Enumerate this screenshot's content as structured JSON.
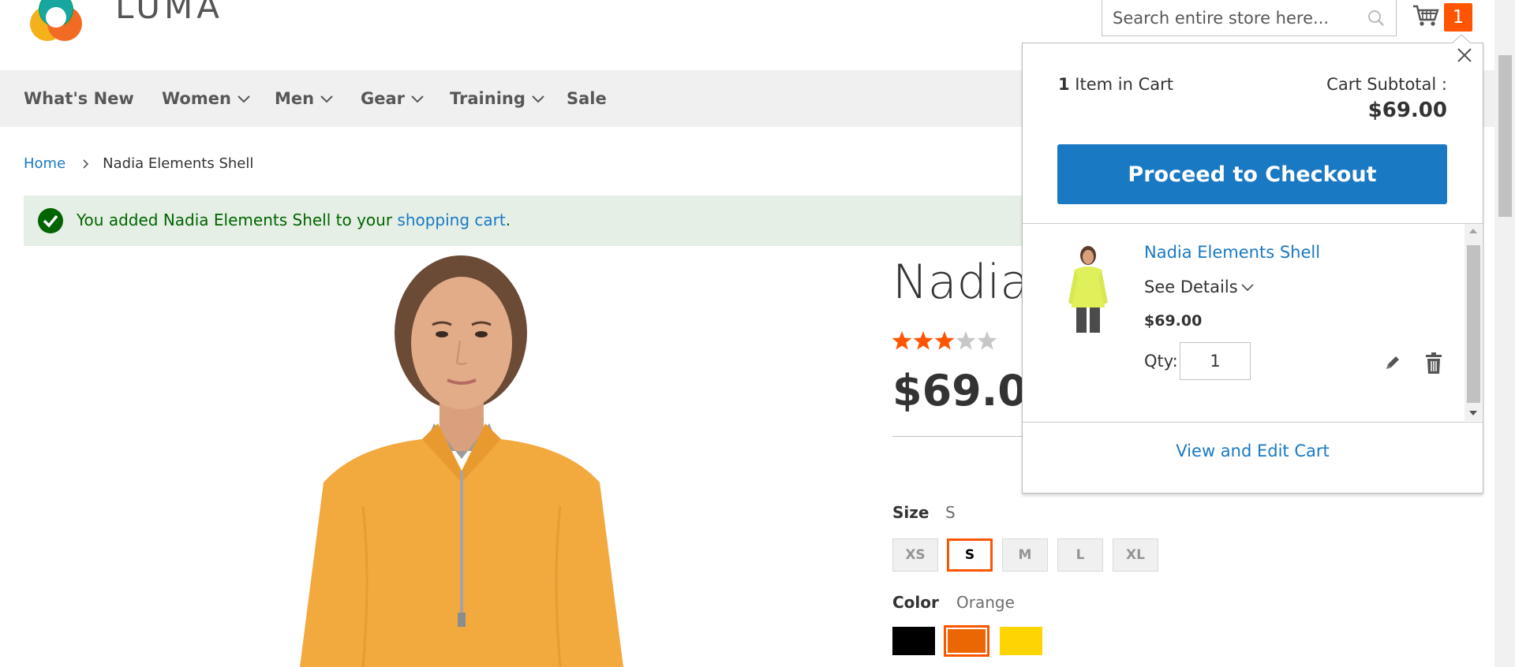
{
  "header": {
    "logo_text": "LUMA",
    "search_placeholder": "Search entire store here...",
    "cart_count": "1"
  },
  "nav": {
    "items": [
      {
        "label": "What's New",
        "has_dropdown": false
      },
      {
        "label": "Women",
        "has_dropdown": true
      },
      {
        "label": "Men",
        "has_dropdown": true
      },
      {
        "label": "Gear",
        "has_dropdown": true
      },
      {
        "label": "Training",
        "has_dropdown": true
      },
      {
        "label": "Sale",
        "has_dropdown": false
      }
    ]
  },
  "breadcrumb": {
    "home": "Home",
    "current": "Nadia Elements Shell"
  },
  "message": {
    "prefix": "You added Nadia Elements Shell to your ",
    "link": "shopping cart",
    "suffix": "."
  },
  "product": {
    "title": "Nadia",
    "rating_stars": 3,
    "rating_max": 5,
    "price": "$69.00",
    "size_label": "Size",
    "size_selected": "S",
    "sizes": [
      "XS",
      "S",
      "M",
      "L",
      "XL"
    ],
    "color_label": "Color",
    "color_selected": "Orange",
    "colors": [
      {
        "name": "Black",
        "hex": "#000000"
      },
      {
        "name": "Orange",
        "hex": "#eb6703"
      },
      {
        "name": "Yellow",
        "hex": "#ffd500"
      }
    ]
  },
  "minicart": {
    "count": "1",
    "count_suffix": " Item in Cart",
    "subtotal_label": "Cart Subtotal :",
    "subtotal_value": "$69.00",
    "checkout_label": "Proceed to Checkout",
    "item": {
      "name": "Nadia Elements Shell",
      "details_label": "See Details",
      "price": "$69.00",
      "qty_label": "Qty:",
      "qty": "1"
    },
    "view_cart_label": "View and Edit Cart"
  },
  "colors": {
    "accent_blue": "#1979c3",
    "accent_orange": "#ff5501",
    "nav_bg": "#f0f0f0",
    "success_bg": "#e5efe5",
    "success_text": "#006400",
    "star_on": "#ff5501",
    "star_off": "#c7c7c7"
  }
}
